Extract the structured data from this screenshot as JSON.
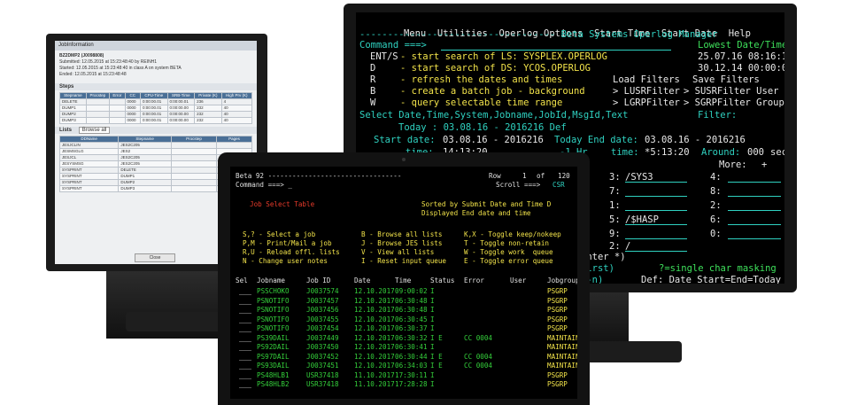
{
  "left_window": {
    "title": "JobInformation",
    "job_header": "BZ2DMP2 (J0098808)",
    "submitted": "Submitted: 12.05.2015   at 15:23:48:40 by REINH1",
    "started": "Started:    12.05.2015   at 15:23:48:40    in class A on system BETA",
    "ended": "Ended:       12.05.2015   at 15:23:48:48",
    "steps_label": "Steps",
    "steps_headers": [
      "Stepname",
      "Procstep",
      "Error",
      "CC",
      "CPU-Time",
      "SRB-Time",
      "Private (K)",
      "High Prv (K)"
    ],
    "steps_rows": [
      [
        "DELETE",
        "",
        "",
        "0000",
        "0:00:00.01",
        "0:00:00.01",
        "236",
        "4"
      ],
      [
        "DUMP1",
        "",
        "",
        "0000",
        "0:00:00.01",
        "0:00:00.00",
        "232",
        "40"
      ],
      [
        "DUMP2",
        "",
        "",
        "0000",
        "0:00:00.01",
        "0:00:00.00",
        "232",
        "40"
      ],
      [
        "DUMP3",
        "",
        "",
        "0000",
        "0:00:00.01",
        "0:00:00.00",
        "232",
        "40"
      ]
    ],
    "lists_label": "Lists",
    "browse_all": "Browse all",
    "lists_headers": [
      "DDName",
      "Stepname",
      "Procstep",
      "Pages"
    ],
    "lists_rows": [
      [
        "JESJCLIN",
        "JES2C205",
        "",
        ""
      ],
      [
        "JESMSGLG",
        "JES2",
        "",
        ""
      ],
      [
        "JESJCL",
        "JES2C205",
        "",
        ""
      ],
      [
        "JESYSMSG",
        "JES2C205",
        "",
        ""
      ],
      [
        "SYSPRINT",
        "DELETE",
        "",
        ""
      ],
      [
        "SYSPRINT",
        "DUMP1",
        "",
        ""
      ],
      [
        "SYSPRINT",
        "DUMP2",
        "",
        ""
      ],
      [
        "SYSPRINT",
        "DUMP3",
        "",
        ""
      ]
    ],
    "close_label": "Close"
  },
  "right_terminal": {
    "menu": [
      "Menu",
      "Utilities",
      "Operlog Options",
      "Start Time",
      "Start Date",
      "Help"
    ],
    "title": "Beta Systems Operlog Manager",
    "command_label": "Command ===>",
    "lowest_label": "Lowest Date/Time",
    "lowest_1": "25.07.16 08:16:19",
    "lowest_2": "30.12.14 00:00:00",
    "opt1_key": "ENT/S",
    "opt1_text": "- start search of LS: SYSPLEX.OPERLOG",
    "opt2_key": "D",
    "opt2_text": "- start search of DS: YCOS.OPERLOG",
    "opt3_key": "R",
    "opt3_text": "- refresh the dates and times",
    "opt4_key": "B",
    "opt4_text": "- create a batch job - background",
    "opt5_key": "W",
    "opt5_text": "- query selectable time range",
    "load_filters": "Load Filters",
    "save_filters": "Save Filters",
    "lusr": "> LUSRFilter",
    "lgrp": "> LGRPFilter",
    "susr": "> SUSRFilter User",
    "sgrp": "> SGRPFilter Group",
    "select_line": "Select Date,Time,System,Jobname,JobId,MsgId,Text",
    "filter_label": "Filter:",
    "today_line": "Today : 03.08.16 - 2016216 Def",
    "start_label": "Start date:",
    "start_val": "03.08.16 - 2016216",
    "end_label": "Today End date:",
    "end_val": "03.08.16 - 2016216",
    "time_label": "time:",
    "time_val": "14:13:20",
    "hr": "-1 Hr",
    "time2_label": "time:",
    "time2_val": "*5:13:20",
    "around_label": "Around:",
    "around_val": "000",
    "secs": "secs",
    "more": "More:",
    "plus": "+",
    "filter_rows": [
      {
        "n": "3:",
        "v": "/SYS3",
        "n2": "4:"
      },
      {
        "n": "7:",
        "v": "",
        "n2": "8:"
      },
      {
        "n": "1:",
        "v": "",
        "n2": "2:"
      },
      {
        "n": "5:",
        "v": "/$HASP",
        "n2": "6:"
      },
      {
        "n": "9:",
        "v": "",
        "n2": "0:"
      },
      {
        "n": "2:",
        "v": "/",
        "n2": ""
      }
    ],
    "enter": "Enter *)",
    "lrst": "(lrst)",
    "masking": "?=single char masking",
    "n_label": "(-n)",
    "def_label": "Def: Date Start=End=Today"
  },
  "laptop": {
    "header_left": "Beta 92 ---------------------------------",
    "row_label": "Row",
    "row_num": "1",
    "of": "of",
    "total": "120",
    "command": "Command ===> _",
    "scroll": "Scroll ===>",
    "scroll_val": "CSR",
    "table_title": "Job Select Table",
    "sorted_by": "Sorted by Submit Date and Time D",
    "displayed": "Displayed End date and time",
    "cmd_rows": [
      [
        "S,? - Select a job",
        "B - Browse all lists",
        "K,X - Toggle keep/nokeep"
      ],
      [
        "P,M - Print/Mail a job",
        "J - Browse JES lists",
        "T - Toggle non-retain"
      ],
      [
        "R,U - Reload offl. lists",
        "V - View all lists",
        "W - Toggle work  queue"
      ],
      [
        "N - Change user notes",
        "I - Reset input queue",
        "E - Toggle error queue"
      ]
    ],
    "col_headers": [
      "Sel",
      "Jobname",
      "Job ID",
      "Date",
      "Time",
      "Status",
      "Error",
      "User",
      "Jobgroup"
    ],
    "rows": [
      [
        "PSSCHOKO",
        "J0037574",
        "12.10.2017",
        "09:00:02",
        "I",
        "",
        "",
        "PSGRP"
      ],
      [
        "PSNOTIFO",
        "J0037457",
        "12.10.2017",
        "06:30:48",
        "I",
        "",
        "",
        "PSGRP"
      ],
      [
        "PSNOTIFO",
        "J0037456",
        "12.10.2017",
        "06:30:48",
        "I",
        "",
        "",
        "PSGRP"
      ],
      [
        "PSNOTIFO",
        "J0037455",
        "12.10.2017",
        "06:30:45",
        "I",
        "",
        "",
        "PSGRP"
      ],
      [
        "PSNOTIFO",
        "J0037454",
        "12.10.2017",
        "06:30:37",
        "I",
        "",
        "",
        "PSGRP"
      ],
      [
        "PS39DAIL",
        "J0037449",
        "12.10.2017",
        "06:30:32",
        "I E",
        "CC 0004",
        "",
        "MAINTAIN"
      ],
      [
        "PS92DAIL",
        "J0037450",
        "12.10.2017",
        "06:30:41",
        "I",
        "",
        "",
        "MAINTAIN"
      ],
      [
        "PS97DAIL",
        "J0037452",
        "12.10.2017",
        "06:30:44",
        "I E",
        "CC 0004",
        "",
        "MAINTAIN"
      ],
      [
        "PS93DAIL",
        "J0037451",
        "12.10.2017",
        "06:34:03",
        "I E",
        "CC 0004",
        "",
        "MAINTAIN"
      ],
      [
        "PS48HLB1",
        "USR37418",
        "11.10.2017",
        "17:30:11",
        "I",
        "",
        "",
        "PSGRP"
      ],
      [
        "PS48HLB2",
        "USR37418",
        "11.10.2017",
        "17:28:28",
        "I",
        "",
        "",
        "PSGRP"
      ]
    ]
  }
}
